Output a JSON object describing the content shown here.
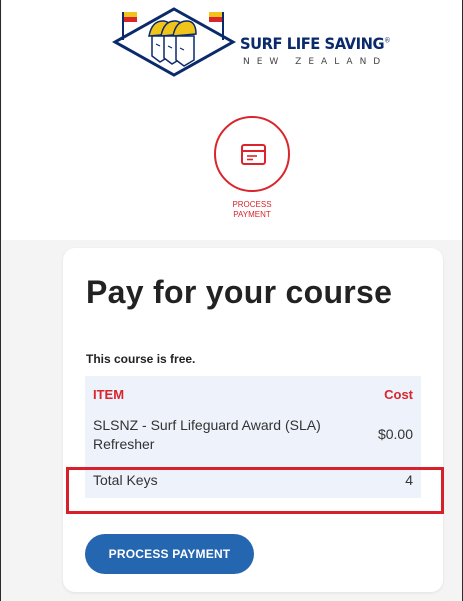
{
  "brand": {
    "name": "SURF LIFE SAVING",
    "registered_mark": "®",
    "country": "NEW ZEALAND",
    "primary_color": "#0a2a6b",
    "accent_color": "#d9252b"
  },
  "step": {
    "icon": "payment-card-icon",
    "label": "PROCESS PAYMENT"
  },
  "card": {
    "title": "Pay for your course",
    "free_note": "This course is free.",
    "table": {
      "headers": {
        "item": "ITEM",
        "cost": "Cost"
      },
      "rows": [
        {
          "item": "SLSNZ - Surf Lifeguard Award (SLA) Refresher",
          "cost": "$0.00"
        }
      ],
      "total": {
        "label": "Total Keys",
        "value": "4"
      }
    },
    "button": {
      "label": "PROCESS PAYMENT",
      "color": "#2566b0"
    }
  }
}
